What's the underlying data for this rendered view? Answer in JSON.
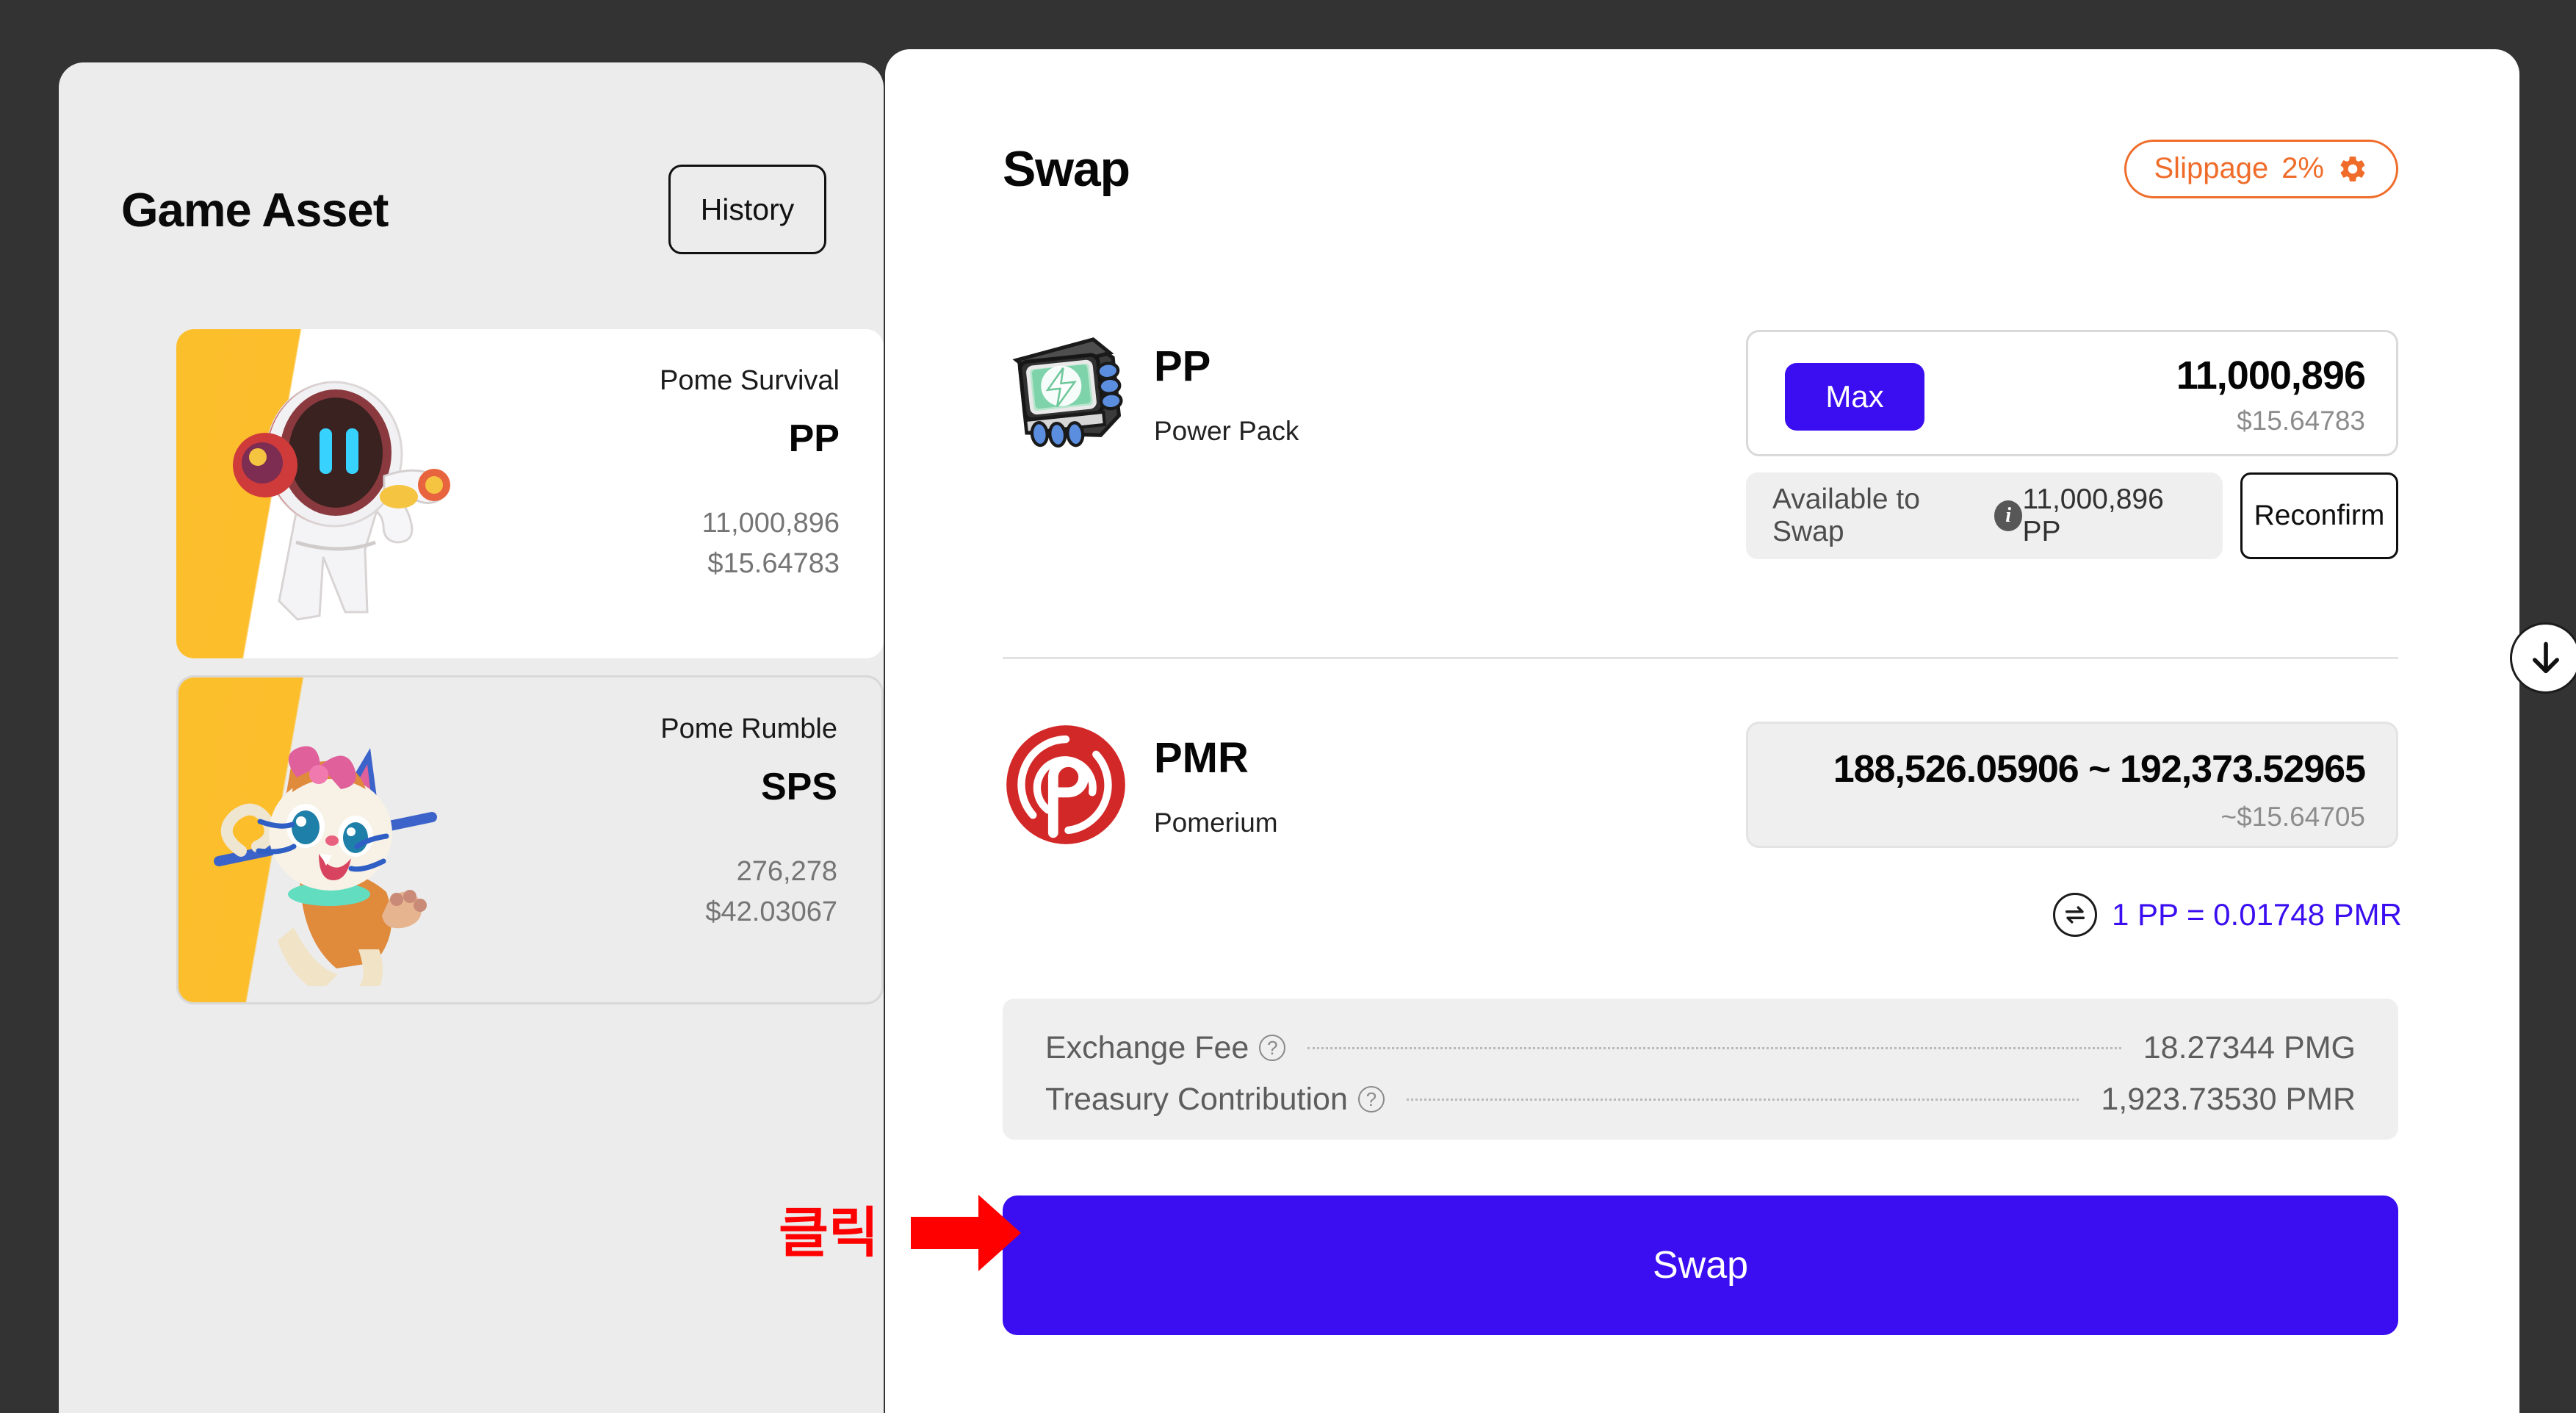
{
  "theme": {
    "page_background": "#333333",
    "accent_blue": "#3a0ef0",
    "accent_orange": "#ef6c2a",
    "annotation_red": "#ff0000",
    "pmr_red": "#d32828"
  },
  "left_panel": {
    "title": "Game Asset",
    "history_button": "History",
    "assets": [
      {
        "game": "Pome Survival",
        "symbol": "PP",
        "amount": "11,000,896",
        "usd": "$15.64783",
        "art": "astronaut-character"
      },
      {
        "game": "Pome Rumble",
        "symbol": "SPS",
        "amount": "276,278",
        "usd": "$42.03067",
        "art": "cat-character"
      }
    ]
  },
  "swap": {
    "title": "Swap",
    "slippage_label": "Slippage",
    "slippage_value": "2%",
    "gear_icon": "gear-icon",
    "from": {
      "icon": "power-pack-icon",
      "symbol": "PP",
      "name": "Power Pack",
      "max_button": "Max",
      "amount": "11,000,896",
      "usd": "$15.64783",
      "available_label": "Available to Swap",
      "available_info_icon": "info-icon",
      "available_value": "11,000,896 PP",
      "reconfirm_button": "Reconfirm"
    },
    "direction_icon": "arrow-down-icon",
    "to": {
      "icon": "pomerium-icon",
      "symbol": "PMR",
      "name": "Pomerium",
      "amount_range": "188,526.05906 ~ 192,373.52965",
      "usd": "~$15.64705"
    },
    "rate": {
      "icon": "swap-horizontal-icon",
      "text": "1 PP = 0.01748 PMR"
    },
    "fees": [
      {
        "label": "Exchange Fee",
        "help_icon": "question-icon",
        "value": "18.27344 PMG"
      },
      {
        "label": "Treasury Contribution",
        "help_icon": "question-icon",
        "value": "1,923.73530 PMR"
      }
    ],
    "submit_button": "Swap"
  },
  "annotation": {
    "text": "클릭",
    "arrow_icon": "right-arrow-annotation"
  }
}
